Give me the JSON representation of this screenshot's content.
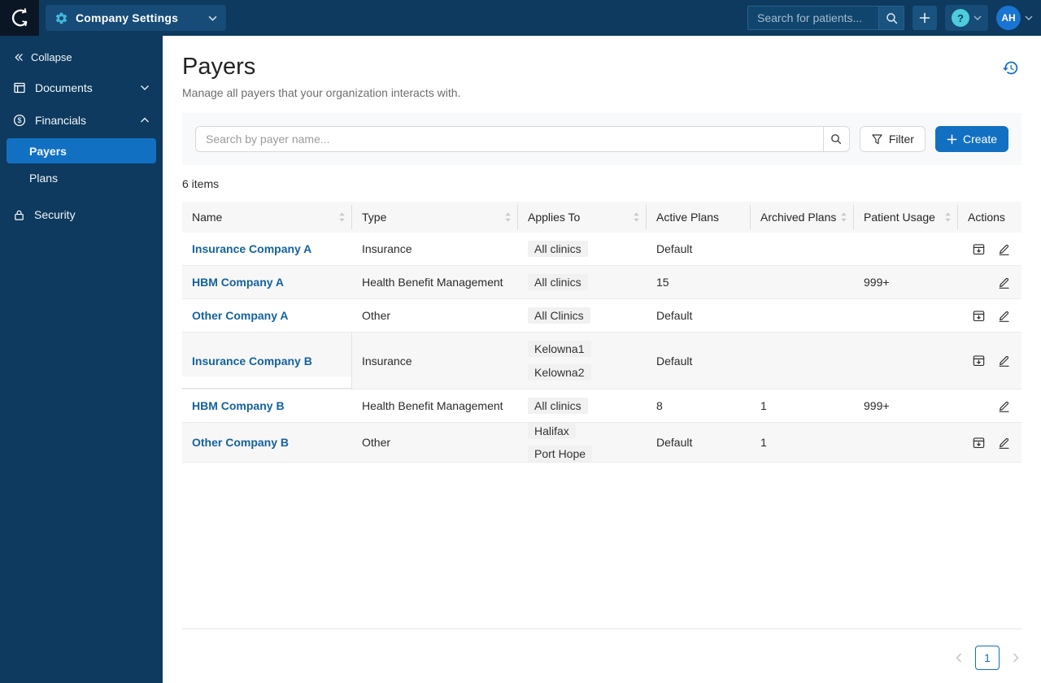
{
  "colors": {
    "navbar_navy": "#0d3a5e",
    "logo_background": "#0b1625",
    "primary_blue": "#1270c2",
    "gear_teal": "#41b8d8",
    "help_teal": "#4ecbdc",
    "avatar_blue": "#1a74d2",
    "link_blue": "#14639e"
  },
  "topbar": {
    "company_settings_label": "Company Settings",
    "patient_search_placeholder": "Search for patients...",
    "help_label": "?",
    "avatar_initials": "AH"
  },
  "sidebar": {
    "collapse_label": "Collapse",
    "items": [
      {
        "label": "Documents",
        "expanded": false
      },
      {
        "label": "Financials",
        "expanded": true
      },
      {
        "label": "Payers",
        "active": true
      },
      {
        "label": "Plans",
        "active": false
      },
      {
        "label": "Security"
      }
    ]
  },
  "page": {
    "title": "Payers",
    "subtitle": "Manage all payers that your organization interacts with.",
    "count_label": "6 items"
  },
  "toolbar": {
    "search_placeholder": "Search by payer name...",
    "filter_label": "Filter",
    "create_label": "Create"
  },
  "table": {
    "columns": [
      {
        "label": "Name",
        "sortable": true
      },
      {
        "label": "Type",
        "sortable": true
      },
      {
        "label": "Applies To",
        "sortable": true
      },
      {
        "label": "Active Plans",
        "sortable": false
      },
      {
        "label": "Archived Plans",
        "sortable": true
      },
      {
        "label": "Patient Usage",
        "sortable": true
      },
      {
        "label": "Actions",
        "sortable": false
      }
    ],
    "rows": [
      {
        "name": "Insurance Company A",
        "type": "Insurance",
        "applies_to": [
          "All clinics"
        ],
        "stacked": false,
        "active_plans": "Default",
        "archived_plans": "",
        "patient_usage": "",
        "actions": [
          "archive",
          "edit"
        ]
      },
      {
        "name": "HBM Company A",
        "type": "Health Benefit Management",
        "applies_to": [
          "All clinics"
        ],
        "stacked": false,
        "active_plans": "15",
        "archived_plans": "",
        "patient_usage": "999+",
        "actions": [
          "edit"
        ]
      },
      {
        "name": "Other Company A",
        "type": "Other",
        "applies_to": [
          "All Clinics"
        ],
        "stacked": false,
        "active_plans": "Default",
        "archived_plans": "",
        "patient_usage": "",
        "actions": [
          "archive",
          "edit"
        ]
      },
      {
        "name": "Insurance Company B",
        "type": "Insurance",
        "applies_to": [
          "Kelowna1",
          "Kelowna2"
        ],
        "stacked": true,
        "active_plans": "Default",
        "archived_plans": "",
        "patient_usage": "",
        "actions": [
          "archive",
          "edit"
        ]
      },
      {
        "name": "HBM Company B",
        "type": "Health Benefit Management",
        "applies_to": [
          "All clinics"
        ],
        "stacked": false,
        "active_plans": "8",
        "archived_plans": "1",
        "patient_usage": "999+",
        "actions": [
          "edit"
        ]
      },
      {
        "name": "Other Company B",
        "type": "Other",
        "applies_to": [
          "Halifax",
          "Port Hope"
        ],
        "stacked": false,
        "active_plans": "Default",
        "archived_plans": "1",
        "patient_usage": "",
        "actions": [
          "archive",
          "edit"
        ]
      }
    ]
  },
  "pagination": {
    "current_page": "1"
  }
}
